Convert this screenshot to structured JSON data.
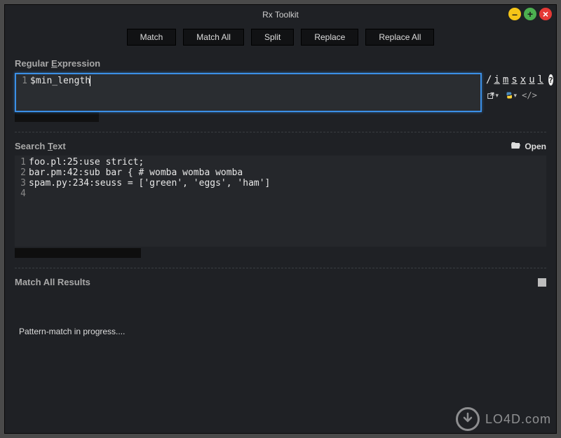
{
  "title": "Rx Toolkit",
  "window_controls": {
    "minimize": "–",
    "maximize": "+",
    "close": "×"
  },
  "toolbar": {
    "match": "Match",
    "match_all": "Match All",
    "split": "Split",
    "replace": "Replace",
    "replace_all": "Replace All"
  },
  "regex": {
    "label_pre": "Regular ",
    "label_mn": "E",
    "label_post": "xpression",
    "line_number": "1",
    "content": "$min_length",
    "flag_slash": "/",
    "flags": {
      "i": "i",
      "m": "m",
      "s": "s",
      "x": "x",
      "u": "u",
      "l": "l"
    },
    "help": "?",
    "icons": {
      "share": "share-arrow-icon",
      "python": "python-icon",
      "code": "code-tag-icon"
    }
  },
  "search": {
    "label_pre": "Search ",
    "label_mn": "T",
    "label_post": "ext",
    "open_label": "Open",
    "lines": [
      {
        "n": "1",
        "text": "foo.pl:25:use strict;"
      },
      {
        "n": "2",
        "text": "bar.pm:42:sub bar { # womba womba womba"
      },
      {
        "n": "3",
        "text": "spam.py:234:seuss = ['green', 'eggs', 'ham']"
      },
      {
        "n": "4",
        "text": ""
      }
    ]
  },
  "results": {
    "label": "Match All Results",
    "status": "Pattern-match in progress...."
  },
  "watermark": {
    "arrow": "↓",
    "text": "LO4D.com"
  }
}
